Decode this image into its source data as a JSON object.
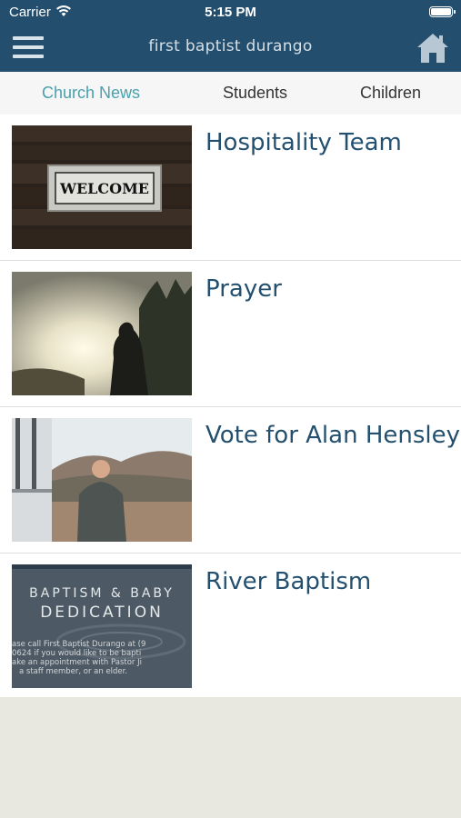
{
  "status": {
    "carrier": "Carrier",
    "time": "5:15 PM"
  },
  "header": {
    "title": "first baptist durango",
    "menu_icon": "hamburger-menu-icon",
    "home_icon": "home-icon"
  },
  "tabs": [
    {
      "label": "Church News",
      "active": true
    },
    {
      "label": "Students",
      "active": false
    },
    {
      "label": "Children",
      "active": false
    }
  ],
  "news": [
    {
      "title": "Hospitality Team",
      "image_text": "WELCOME"
    },
    {
      "title": "Prayer"
    },
    {
      "title": "Vote for Alan Hensley"
    },
    {
      "title": "River Baptism",
      "image_heading": [
        "BAPTISM & BABY",
        "DEDICATION"
      ],
      "image_text": [
        "ase call First Baptist Durango at (9",
        "0624 if you would like to be bapti",
        "ake an appointment with Pastor Ji",
        "a staff member, or an elder."
      ]
    }
  ],
  "colors": {
    "header": "#244e6d",
    "active_tab": "#4aa0ad",
    "item_title": "#24506f",
    "footer_bg": "#e8e8e1"
  }
}
